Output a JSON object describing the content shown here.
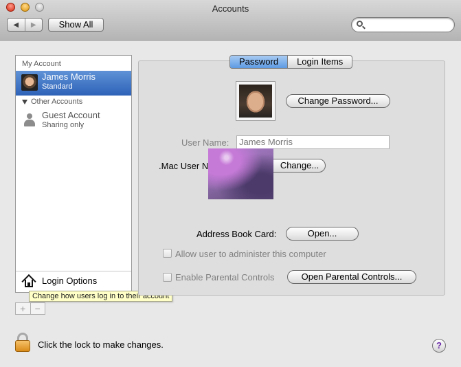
{
  "window": {
    "title": "Accounts"
  },
  "toolbar": {
    "back_glyph": "◀",
    "forward_glyph": "▶",
    "show_all_label": "Show All",
    "search_placeholder": ""
  },
  "sidebar": {
    "my_account_header": "My Account",
    "selected_user": {
      "name": "James Morris",
      "role": "Standard"
    },
    "other_accounts_header": "Other Accounts",
    "guest": {
      "name": "Guest Account",
      "status": "Sharing only"
    },
    "login_options_label": "Login Options",
    "add_label": "+",
    "remove_label": "−",
    "tooltip": "Change how users log in to their account"
  },
  "tabs": [
    {
      "label": "Password",
      "active": true
    },
    {
      "label": "Login Items",
      "active": false
    }
  ],
  "form": {
    "change_password_label": "Change Password...",
    "user_name_label": "User Name:",
    "user_name_value": "James Morris",
    "mac_user_label": ".Mac User N",
    "mac_change_label": "Change...",
    "address_book_label": "Address Book Card:",
    "open_label": "Open...",
    "allow_admin_label": "Allow user to administer this computer",
    "parental_label": "Enable Parental Controls",
    "open_parental_label": "Open Parental Controls..."
  },
  "footer": {
    "lock_text": "Click the lock to make changes.",
    "help_glyph": "?"
  }
}
